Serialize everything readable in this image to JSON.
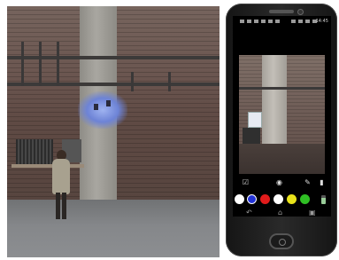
{
  "phone": {
    "status_time": "14:45",
    "palette": [
      {
        "name": "white",
        "color": "#ffffff"
      },
      {
        "name": "blue",
        "color": "#2233d6"
      },
      {
        "name": "red",
        "color": "#e21b1b"
      },
      {
        "name": "white",
        "color": "#ffffff"
      },
      {
        "name": "yellow",
        "color": "#e8e21a"
      },
      {
        "name": "green",
        "color": "#2fbf24"
      }
    ],
    "tools": [
      "checkbox-pencil-icon",
      "camera-icon",
      "brush-icon",
      "eraser-icon"
    ],
    "nav": [
      "back-icon",
      "home-icon",
      "recent-apps-icon"
    ]
  }
}
